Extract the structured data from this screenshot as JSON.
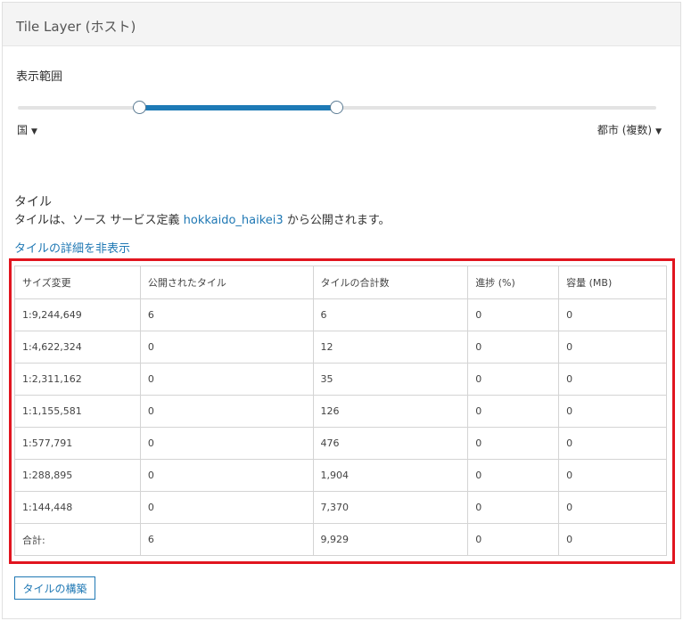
{
  "panel": {
    "title": "Tile Layer (ホスト)"
  },
  "range": {
    "label": "表示範囲",
    "min_label": "国",
    "max_label": "都市 (複数)",
    "caret": "▼"
  },
  "tiles": {
    "heading": "タイル",
    "desc_prefix": "タイルは、ソース サービス定義 ",
    "desc_link": "hokkaido_haikei3",
    "desc_suffix": " から公開されます。",
    "hide_link": "タイルの詳細を非表示"
  },
  "table": {
    "headers": [
      "サイズ変更",
      "公開されたタイル",
      "タイルの合計数",
      "進捗 (%)",
      "容量 (MB)"
    ],
    "rows": [
      [
        "1:9,244,649",
        "6",
        "6",
        "0",
        "0"
      ],
      [
        "1:4,622,324",
        "0",
        "12",
        "0",
        "0"
      ],
      [
        "1:2,311,162",
        "0",
        "35",
        "0",
        "0"
      ],
      [
        "1:1,155,581",
        "0",
        "126",
        "0",
        "0"
      ],
      [
        "1:577,791",
        "0",
        "476",
        "0",
        "0"
      ],
      [
        "1:288,895",
        "0",
        "1,904",
        "0",
        "0"
      ],
      [
        "1:144,448",
        "0",
        "7,370",
        "0",
        "0"
      ],
      [
        "合計:",
        "6",
        "9,929",
        "0",
        "0"
      ]
    ]
  },
  "build_button": "タイルの構築",
  "colors": {
    "accent": "#1d7ab6",
    "highlight": "#e1151f"
  }
}
